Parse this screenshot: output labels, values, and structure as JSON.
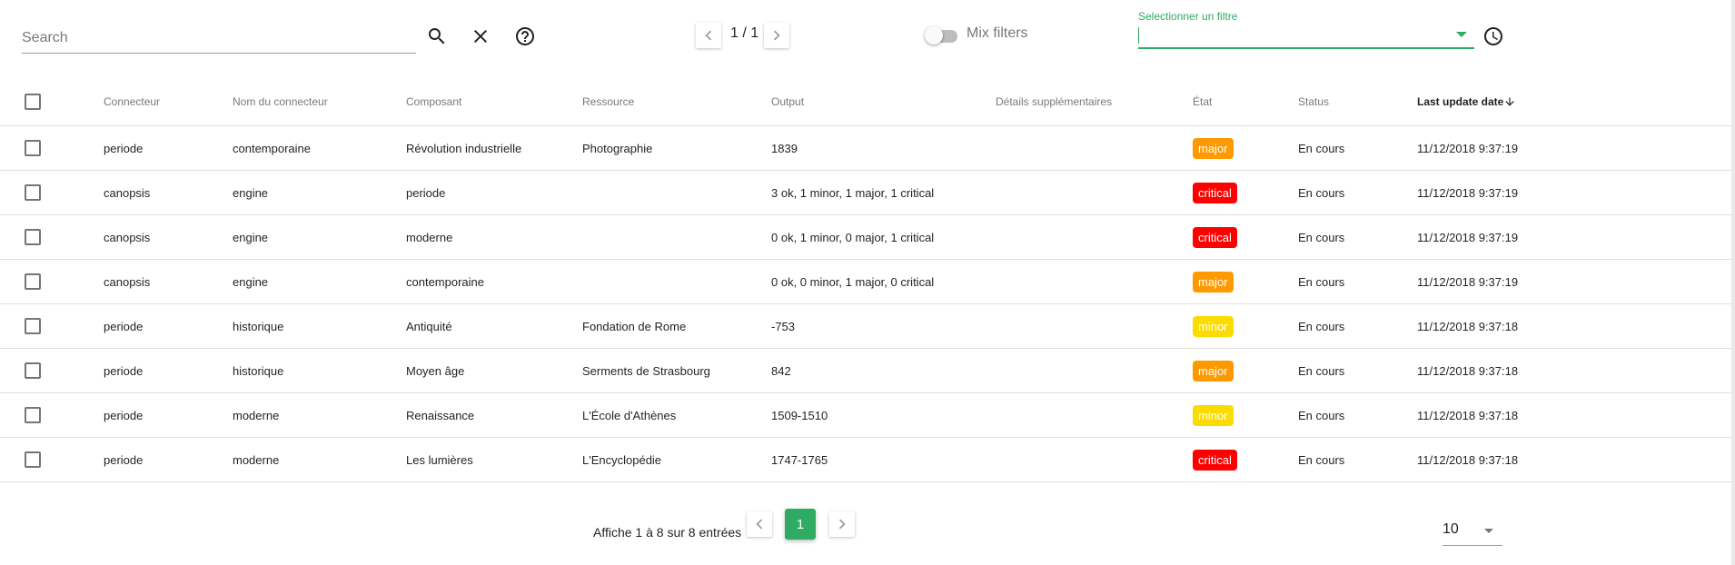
{
  "toolbar": {
    "search_placeholder": "Search",
    "page_indicator": "1 / 1",
    "mix_filters_label": "Mix filters",
    "filter_label": "Selectionner un filtre",
    "filter_value": ""
  },
  "table": {
    "headers": {
      "connecteur": "Connecteur",
      "nom_connecteur": "Nom du connecteur",
      "composant": "Composant",
      "ressource": "Ressource",
      "output": "Output",
      "details": "Détails supplémentaires",
      "etat": "État",
      "status": "Status",
      "last_update": "Last update date"
    },
    "rows": [
      {
        "connecteur": "periode",
        "nom": "contemporaine",
        "composant": "Révolution industrielle",
        "ressource": "Photographie",
        "output": "1839",
        "etat": "major",
        "status": "En cours",
        "date": "11/12/2018 9:37:19"
      },
      {
        "connecteur": "canopsis",
        "nom": "engine",
        "composant": "periode",
        "ressource": "",
        "output": "3 ok, 1 minor, 1 major, 1 critical",
        "etat": "critical",
        "status": "En cours",
        "date": "11/12/2018 9:37:19"
      },
      {
        "connecteur": "canopsis",
        "nom": "engine",
        "composant": "moderne",
        "ressource": "",
        "output": "0 ok, 1 minor, 0 major, 1 critical",
        "etat": "critical",
        "status": "En cours",
        "date": "11/12/2018 9:37:19"
      },
      {
        "connecteur": "canopsis",
        "nom": "engine",
        "composant": "contemporaine",
        "ressource": "",
        "output": "0 ok, 0 minor, 1 major, 0 critical",
        "etat": "major",
        "status": "En cours",
        "date": "11/12/2018 9:37:19"
      },
      {
        "connecteur": "periode",
        "nom": "historique",
        "composant": "Antiquité",
        "ressource": "Fondation de Rome",
        "output": "-753",
        "etat": "minor",
        "status": "En cours",
        "date": "11/12/2018 9:37:18"
      },
      {
        "connecteur": "periode",
        "nom": "historique",
        "composant": "Moyen âge",
        "ressource": "Serments de Strasbourg",
        "output": "842",
        "etat": "major",
        "status": "En cours",
        "date": "11/12/2018 9:37:18"
      },
      {
        "connecteur": "periode",
        "nom": "moderne",
        "composant": "Renaissance",
        "ressource": "L'École d'Athènes",
        "output": "1509-1510",
        "etat": "minor",
        "status": "En cours",
        "date": "11/12/2018 9:37:18"
      },
      {
        "connecteur": "periode",
        "nom": "moderne",
        "composant": "Les lumières",
        "ressource": "L'Encyclopédie",
        "output": "1747-1765",
        "etat": "critical",
        "status": "En cours",
        "date": "11/12/2018 9:37:18"
      }
    ]
  },
  "footer": {
    "info": "Affiche 1 à 8 sur 8 entrées",
    "current_page": "1",
    "per_page": "10"
  },
  "colors": {
    "accent": "#2fab63",
    "major": "#ff9900",
    "critical": "#ff0000",
    "minor": "#fcdc00"
  },
  "icons": {
    "search": "search-icon",
    "clear": "close-icon",
    "help": "help-circle-icon",
    "history": "clock-icon",
    "row_actions": [
      "playlist-check-icon",
      "check-icon",
      "more-vert-icon"
    ]
  }
}
